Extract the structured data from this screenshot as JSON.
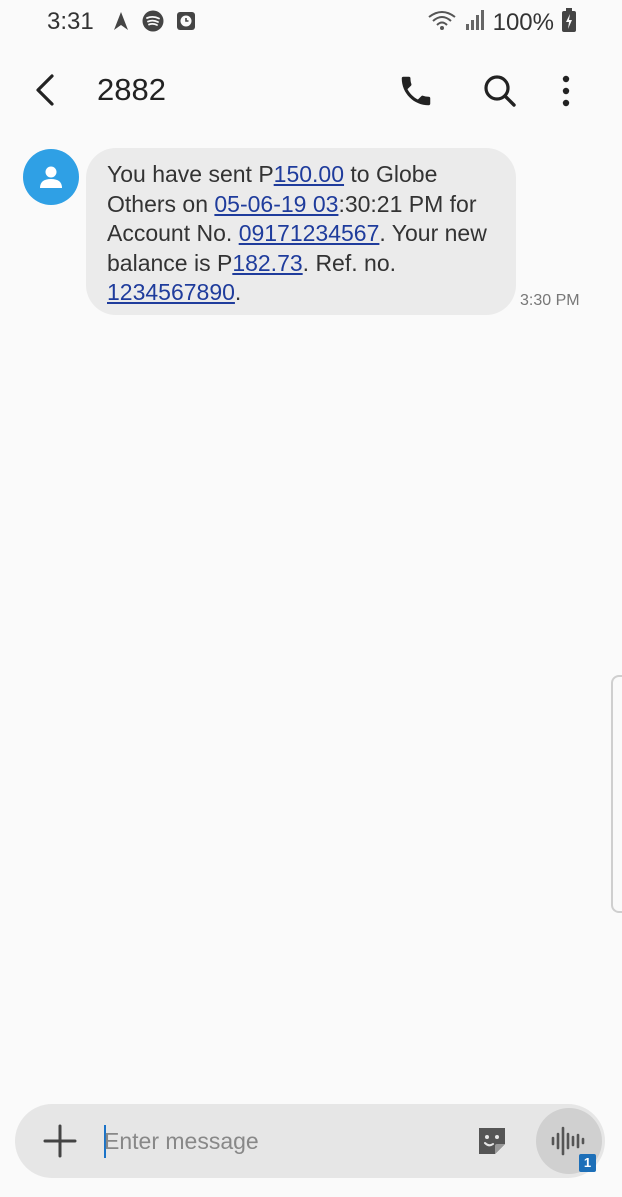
{
  "status_bar": {
    "time": "3:31",
    "battery": "100%",
    "icons": [
      "navigation-icon",
      "spotify-icon",
      "clock-icon",
      "wifi-icon",
      "signal-icon",
      "battery-charging-icon"
    ]
  },
  "header": {
    "title": "2882",
    "icons": [
      "back-arrow-icon",
      "phone-icon",
      "search-icon",
      "more-vert-icon"
    ]
  },
  "message": {
    "part1": "You have sent P",
    "amount": "150.00",
    "part2": " to Globe Others on ",
    "date": "05-06-19 03",
    "part3": ":30:21 PM for Account No. ",
    "account": "09171234567",
    "part4": ". Your new balance is P",
    "balance": "182.73",
    "part5": ". Ref. no. ",
    "ref": "1234567890",
    "part6": ".",
    "time": "3:30 PM"
  },
  "composer": {
    "placeholder": "Enter message",
    "sim_slot": "1"
  },
  "colors": {
    "avatar": "#2fa0e5",
    "link": "#1f3c9c",
    "bubble": "#ebebeb",
    "composer": "#e6e6e6"
  }
}
